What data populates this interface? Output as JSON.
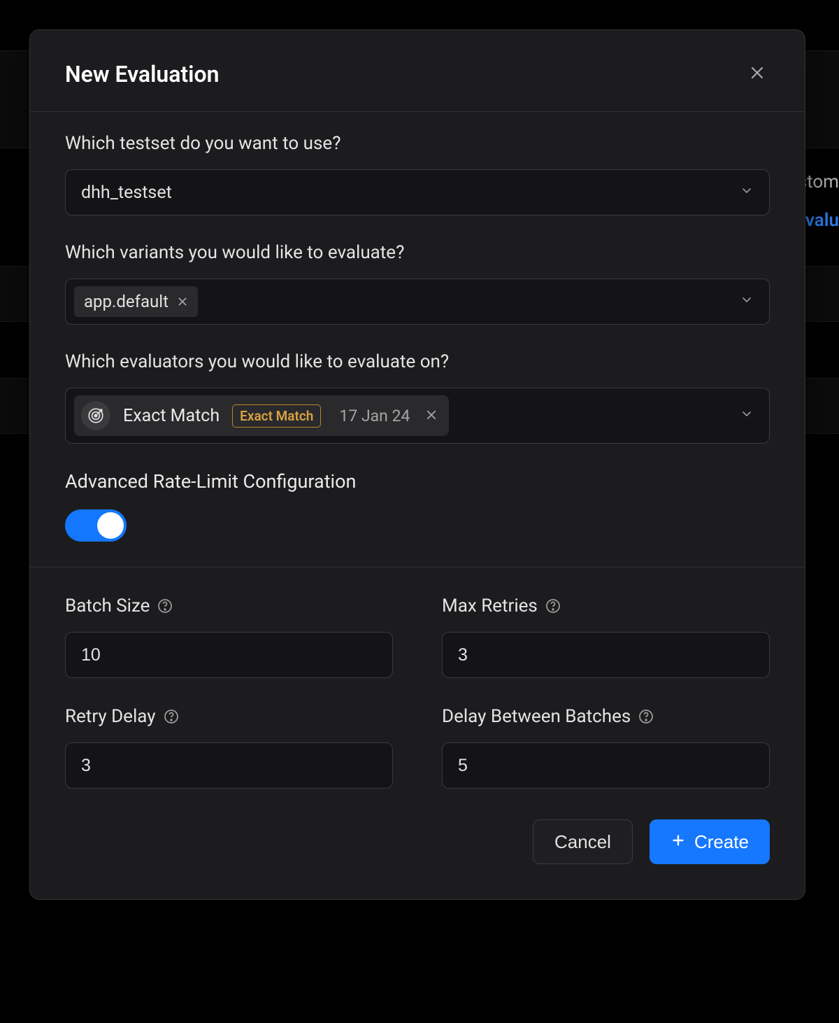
{
  "background": {
    "partial_text_1": "stom",
    "partial_text_2": "Evalu"
  },
  "modal": {
    "title": "New Evaluation",
    "testset": {
      "label": "Which testset do you want to use?",
      "value": "dhh_testset"
    },
    "variants": {
      "label": "Which variants you would like to evaluate?",
      "items": [
        {
          "name": "app.default"
        }
      ]
    },
    "evaluators": {
      "label": "Which evaluators you would like to evaluate on?",
      "items": [
        {
          "title": "Exact Match",
          "badge": "Exact Match",
          "date": "17 Jan 24"
        }
      ]
    },
    "rate_limit": {
      "title": "Advanced Rate-Limit Configuration",
      "enabled": true,
      "batch_size": {
        "label": "Batch Size",
        "value": "10"
      },
      "max_retries": {
        "label": "Max Retries",
        "value": "3"
      },
      "retry_delay": {
        "label": "Retry Delay",
        "value": "3"
      },
      "delay_between_batches": {
        "label": "Delay Between Batches",
        "value": "5"
      }
    },
    "footer": {
      "cancel": "Cancel",
      "create": "Create"
    }
  }
}
